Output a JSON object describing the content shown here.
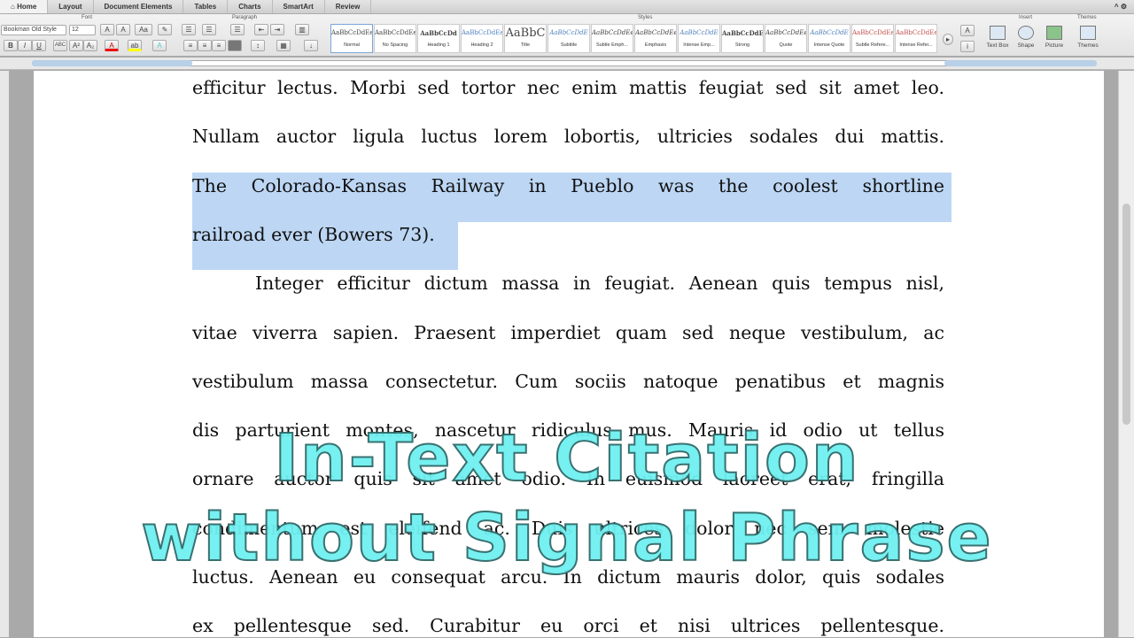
{
  "tabs": [
    "Home",
    "Layout",
    "Document Elements",
    "Tables",
    "Charts",
    "SmartArt",
    "Review"
  ],
  "ribbon": {
    "group_font": "Font",
    "group_paragraph": "Paragraph",
    "group_styles": "Styles",
    "group_insert": "Insert",
    "group_themes": "Themes",
    "font_name": "Bookman Old Style",
    "font_size": "12",
    "styles": [
      {
        "sample": "AaBbCcDdEe",
        "name": "Normal"
      },
      {
        "sample": "AaBbCcDdEe",
        "name": "No Spacing"
      },
      {
        "sample": "AaBbCcDd",
        "name": "Heading 1"
      },
      {
        "sample": "AaBbCcDdEe",
        "name": "Heading 2"
      },
      {
        "sample": "AaBbC",
        "name": "Title"
      },
      {
        "sample": "AaBbCcDdE",
        "name": "Subtitle"
      },
      {
        "sample": "AaBbCcDdEe",
        "name": "Subtle Emph..."
      },
      {
        "sample": "AaBbCcDdEe",
        "name": "Emphasis"
      },
      {
        "sample": "AaBbCcDdE",
        "name": "Intense Emp..."
      },
      {
        "sample": "AaBbCcDdE",
        "name": "Strong"
      },
      {
        "sample": "AaBbCcDdEe",
        "name": "Quote"
      },
      {
        "sample": "AaBbCcDdE",
        "name": "Intense Quote"
      },
      {
        "sample": "AaBbCcDdEe",
        "name": "Subtle Refere..."
      },
      {
        "sample": "AaBbCcDdEe",
        "name": "Intense Refer..."
      }
    ],
    "insert": [
      "Text Box",
      "Shape",
      "Picture"
    ],
    "themes": "Themes"
  },
  "document": {
    "lines": [
      "efficitur lectus. Morbi sed tortor nec enim mattis feugiat sed sit amet leo.",
      "Nullam auctor ligula luctus lorem lobortis, ultricies sodales dui mattis.",
      "The Colorado-Kansas Railway in Pueblo was the coolest shortline",
      "railroad ever (Bowers 73).",
      "Integer efficitur dictum massa in feugiat. Aenean quis tempus nisl,",
      "vitae viverra sapien. Praesent imperdiet quam sed neque vestibulum, ac",
      "vestibulum massa consectetur. Cum sociis natoque penatibus et magnis",
      "dis parturient montes, nascetur ridiculus mus. Mauris id odio ut tellus",
      "ornare auctor quis sit amet odio. In euismod laoreet erat, fringilla",
      "condimentum est eleifend ac. Duis ultrices dolor nec sem molestie",
      "luctus. Aenean eu consequat arcu. In dictum mauris dolor, quis sodales",
      "ex pellentesque sed. Curabitur eu orci et nisi ultrices pellentesque."
    ]
  },
  "overlay": {
    "line1": "In-Text Citation",
    "line2": "without Signal Phrase",
    "color": "#6ff0f0"
  },
  "colors": {
    "selection": "#bcd6f4"
  }
}
